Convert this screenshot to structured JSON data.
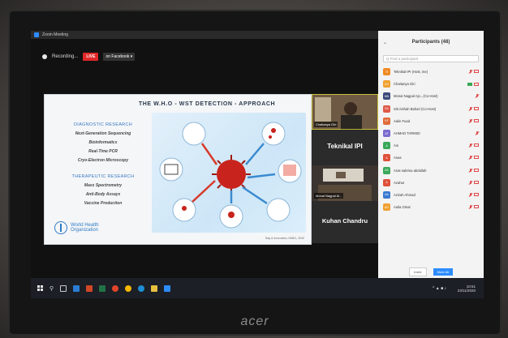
{
  "window": {
    "title": "Zoom Meeting"
  },
  "recording": {
    "status": "Recording...",
    "live_label": "LIVE",
    "live_on": "on Facebook ▾"
  },
  "slide": {
    "title": "THE W.H.O - WST DETECTION - APPROACH",
    "diagnostic_heading": "DIAGNOSTIC RESEARCH",
    "diagnostic_items": [
      "Next-Generation Sequencing",
      "Bioinformatics",
      "Real-Time PCR",
      "Cryo-Electron Microscopy"
    ],
    "therapeutic_heading": "THERAPEUTIC RESEARCH",
    "therapeutic_items": [
      "Mass Spectrometry",
      "Anti-Body Assays",
      "Vaccine Production"
    ],
    "org_line1": "World Health",
    "org_line2": "Organization",
    "footer": "Ray & Innovation, 09/8/1, 2020"
  },
  "tiles": [
    {
      "name_tag": "Chaitanya Giri"
    },
    {
      "label": "Teknikal IPI"
    },
    {
      "name_tag": "Monal Nagpal Ai..."
    },
    {
      "label": "Kuhan Chandru"
    }
  ],
  "participants": {
    "title": "Participants (48)",
    "search_placeholder": "Q Find a participant",
    "list": [
      {
        "initials": "TI",
        "name": "Teknikal IPI (Host, me)",
        "color": "#f08a24"
      },
      {
        "initials": "CG",
        "name": "Chaitanya Giri",
        "color": "#f0a030"
      },
      {
        "initials": "MN",
        "name": "Monal Nagpal Ajo...(Co-Host)",
        "color": "#3b4a7a"
      },
      {
        "initials": "SA",
        "name": "Siti Aishah Bahari (Co-Host)",
        "color": "#e05a4a"
      },
      {
        "initials": "KF",
        "name": "Aalin Fuad",
        "color": "#e06a3a"
      },
      {
        "initials": "AT",
        "name": "AHMAD TARMIZI",
        "color": "#7a6ad0"
      },
      {
        "initials": "A",
        "name": "Ain",
        "color": "#3aa858"
      },
      {
        "initials": "A",
        "name": "Anas",
        "color": "#e0503a"
      },
      {
        "initials": "AS",
        "name": "Aras sabrina abdullah",
        "color": "#3aa858"
      },
      {
        "initials": "A",
        "name": "Azahar",
        "color": "#e0503a"
      },
      {
        "initials": "AA",
        "name": "Azizah Ahmad",
        "color": "#3a7ad0"
      },
      {
        "initials": "AO",
        "name": "Aulia Omar",
        "color": "#f0a030"
      }
    ],
    "invite_label": "Invite",
    "mute_all_label": "Mute All"
  },
  "taskbar": {
    "time": "10:51",
    "date": "23/11/2020"
  },
  "monitor": {
    "brand": "acer"
  }
}
